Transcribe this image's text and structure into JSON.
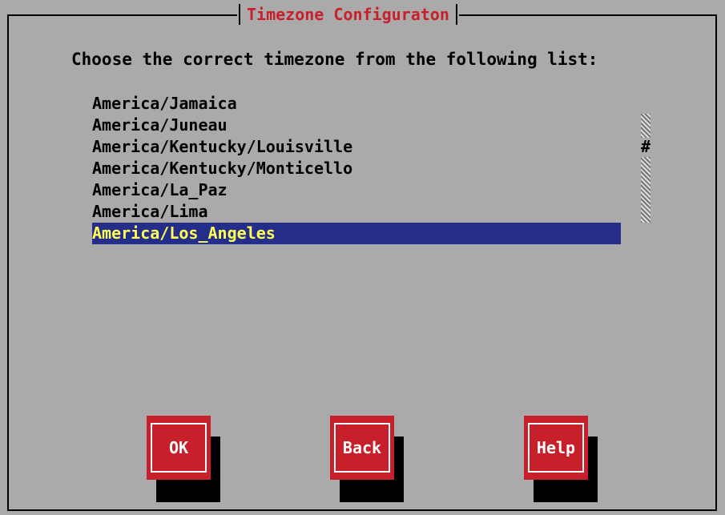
{
  "dialog": {
    "title": "Timezone Configuraton",
    "prompt": "Choose the correct timezone from the following list:"
  },
  "timezone_list": {
    "items": [
      "America/Jamaica",
      "America/Juneau",
      "America/Kentucky/Louisville",
      "America/Kentucky/Monticello",
      "America/La_Paz",
      "America/Lima",
      "America/Los_Angeles"
    ],
    "selected": "America/Los_Angeles",
    "scroll_thumb_glyph": "#"
  },
  "buttons": {
    "ok_label": "OK",
    "back_label": "Back",
    "help_label": "Help"
  },
  "colors": {
    "background": "#aaaaaa",
    "title_text": "#c8202a",
    "selection_bg": "#242e8a",
    "selection_text": "#ffff55",
    "button_bg": "#c8202a",
    "button_text": "#ffffff"
  }
}
